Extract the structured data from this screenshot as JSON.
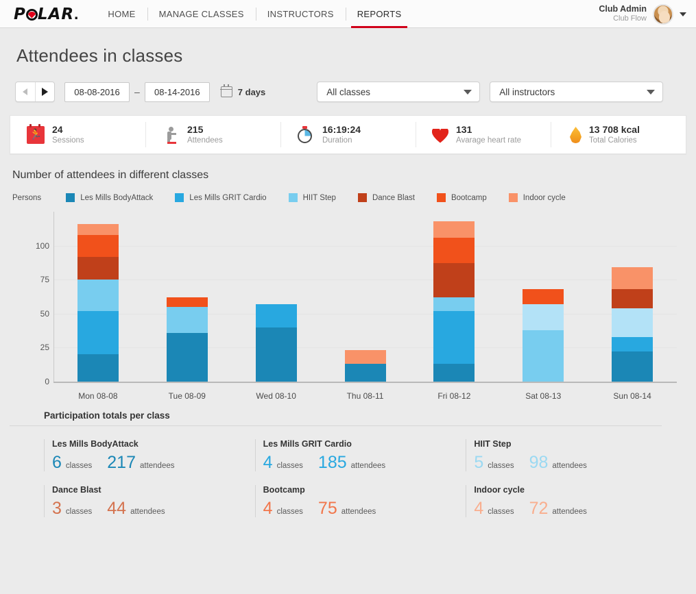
{
  "topnav": {
    "brand": "POLAR",
    "brand_dot": ".",
    "items": [
      {
        "label": "HOME",
        "active": false
      },
      {
        "label": "MANAGE CLASSES",
        "active": false
      },
      {
        "label": "INSTRUCTORS",
        "active": false
      },
      {
        "label": "REPORTS",
        "active": true
      }
    ],
    "user_name": "Club Admin",
    "user_club": "Club Flow"
  },
  "page": {
    "title": "Attendees in classes"
  },
  "controls": {
    "date_from": "08-08-2016",
    "date_dash": "–",
    "date_to": "08-14-2016",
    "range_label": "7 days",
    "classes_select": "All classes",
    "instructors_select": "All instructors"
  },
  "stats": [
    {
      "icon": "calendar-runner-icon",
      "value": "24",
      "label": "Sessions"
    },
    {
      "icon": "person-icon",
      "value": "215",
      "label": "Attendees"
    },
    {
      "icon": "stopwatch-icon",
      "value": "16:19:24",
      "label": "Duration"
    },
    {
      "icon": "heart-icon",
      "value": "131",
      "label": "Avarage heart rate"
    },
    {
      "icon": "flame-icon",
      "value": "13 708 kcal",
      "label": "Total Calories"
    }
  ],
  "chart_data": {
    "type": "bar",
    "stacked": true,
    "title": "Number of attendees in different classes",
    "ylabel": "Persons",
    "xlabel": "",
    "ylim": [
      0,
      125
    ],
    "yticks": [
      0,
      25,
      50,
      75,
      100
    ],
    "grid": true,
    "legend_position": "top",
    "categories": [
      "Mon 08-08",
      "Tue 08-09",
      "Wed 08-10",
      "Thu 08-11",
      "Fri 08-12",
      "Sat 08-13",
      "Sun 08-14"
    ],
    "series": [
      {
        "name": "Les Mills BodyAttack",
        "color": "#1b87b6",
        "values": [
          20,
          36,
          40,
          13,
          13,
          0,
          22
        ]
      },
      {
        "name": "Les Mills GRIT Cardio",
        "color": "#28a8e0",
        "values": [
          32,
          0,
          17,
          0,
          39,
          0,
          11
        ]
      },
      {
        "name": "HIIT Step",
        "color": "#78cdef",
        "values": [
          23,
          19,
          0,
          0,
          10,
          38,
          0
        ]
      },
      {
        "name": "HIIT Step light",
        "color": "#b3e2f7",
        "values": [
          0,
          0,
          0,
          0,
          0,
          19,
          21
        ]
      },
      {
        "name": "Dance Blast",
        "color": "#c0401a",
        "values": [
          17,
          0,
          0,
          0,
          25,
          0,
          14
        ]
      },
      {
        "name": "Bootcamp",
        "color": "#f1511b",
        "values": [
          16,
          7,
          0,
          0,
          19,
          11,
          0
        ]
      },
      {
        "name": "Indoor cycle",
        "color": "#f99268",
        "values": [
          8,
          0,
          0,
          10,
          12,
          0,
          16
        ]
      }
    ],
    "totals": [
      116,
      62,
      57,
      23,
      118,
      68,
      84
    ]
  },
  "legend": [
    {
      "label": "Les Mills BodyAttack",
      "color": "#1b87b6"
    },
    {
      "label": "Les Mills GRIT Cardio",
      "color": "#28a8e0"
    },
    {
      "label": "HIIT Step",
      "color": "#78cdef"
    },
    {
      "label": "Dance Blast",
      "color": "#c0401a"
    },
    {
      "label": "Bootcamp",
      "color": "#f1511b"
    },
    {
      "label": "Indoor cycle",
      "color": "#f99268"
    }
  ],
  "totals_section": {
    "heading": "Participation totals per class",
    "classes_unit": "classes",
    "attendees_unit": "attendees",
    "items": [
      {
        "name": "Les Mills BodyAttack",
        "classes": "6",
        "attendees": "217",
        "color": "#1b87b6"
      },
      {
        "name": "Les Mills GRIT Cardio",
        "classes": "4",
        "attendees": "185",
        "color": "#28a8e0"
      },
      {
        "name": "HIIT Step",
        "classes": "5",
        "attendees": "98",
        "color": "#9bd9f2"
      },
      {
        "name": "Dance Blast",
        "classes": "3",
        "attendees": "44",
        "color": "#d4734f"
      },
      {
        "name": "Bootcamp",
        "classes": "4",
        "attendees": "75",
        "color": "#f1764b"
      },
      {
        "name": "Indoor cycle",
        "classes": "4",
        "attendees": "72",
        "color": "#f9ae8e"
      }
    ]
  }
}
